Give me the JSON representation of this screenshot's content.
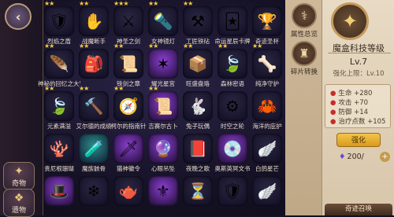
{
  "back": {
    "icon": "back-arrow-icon",
    "glyph": "‹"
  },
  "side_tabs": [
    {
      "label": "奇物",
      "icon": "curio-icon",
      "glyph": "✦"
    },
    {
      "label": "遗物",
      "icon": "relic-icon",
      "glyph": "❖"
    }
  ],
  "items": [
    {
      "name": "烈焰之盾",
      "stars": 2,
      "glyph": "🛡",
      "bg": "dim"
    },
    {
      "name": "战魔断手",
      "stars": 2,
      "glyph": "✋",
      "bg": "dim"
    },
    {
      "name": "神圣之剑",
      "stars": 3,
      "glyph": "⚔",
      "bg": "dim"
    },
    {
      "name": "女神镜灯",
      "stars": 2,
      "glyph": "🔦",
      "bg": "dim"
    },
    {
      "name": "工匠铁砧",
      "stars": 2,
      "glyph": "⚒",
      "bg": "dim"
    },
    {
      "name": "命运星辰卡牌",
      "stars": 0,
      "glyph": "🃏",
      "bg": "dim"
    },
    {
      "name": "奇迹圣杯",
      "stars": 0,
      "glyph": "🏆",
      "bg": "dim"
    },
    {
      "name": "神秘的回忆之大冒险家的背包",
      "stars": 2,
      "glyph": "🪶",
      "bg": "dim"
    },
    {
      "name": "",
      "stars": 2,
      "glyph": "🎒",
      "bg": "dim"
    },
    {
      "name": "铁剑之章",
      "stars": 2,
      "glyph": "📜",
      "bg": "dim"
    },
    {
      "name": "耀光星宫",
      "stars": 2,
      "glyph": "✶",
      "bg": "purple"
    },
    {
      "name": "旺盛盘珞",
      "stars": 2,
      "glyph": "📦",
      "bg": "dim"
    },
    {
      "name": "森林密语",
      "stars": 2,
      "glyph": "🍃",
      "bg": "dim"
    },
    {
      "name": "纯净守护",
      "stars": 2,
      "glyph": "🦴",
      "bg": "dim"
    },
    {
      "name": "元素满溢",
      "stars": 2,
      "glyph": "🍃",
      "bg": "dim"
    },
    {
      "name": "艾尔德的成绩",
      "stars": 2,
      "glyph": "🔨",
      "bg": "dim"
    },
    {
      "name": "柯尔的指南针",
      "stars": 2,
      "glyph": "🧭",
      "bg": "dim"
    },
    {
      "name": "吉赛尔古卜",
      "stars": 2,
      "glyph": "📜",
      "bg": "purple"
    },
    {
      "name": "兔子玩偶",
      "stars": 0,
      "glyph": "🐇",
      "bg": "dim"
    },
    {
      "name": "时空之轮",
      "stars": 0,
      "glyph": "⚙",
      "bg": "dim"
    },
    {
      "name": "海洋的庇护",
      "stars": 0,
      "glyph": "🦀",
      "bg": "dim"
    },
    {
      "name": "贵尼根珊瑚",
      "stars": 0,
      "glyph": "🪸",
      "bg": "dim"
    },
    {
      "name": "魔族骸骨",
      "stars": 0,
      "glyph": "🧪",
      "bg": "teal"
    },
    {
      "name": "猫神徽令",
      "stars": 0,
      "glyph": "🗡",
      "bg": "purple"
    },
    {
      "name": "心眼吊坠",
      "stars": 0,
      "glyph": "🔮",
      "bg": "purple"
    },
    {
      "name": "夜晚之歌",
      "stars": 0,
      "glyph": "📕",
      "bg": "dim"
    },
    {
      "name": "奥斯英冥文书",
      "stars": 0,
      "glyph": "💿",
      "bg": "purple"
    },
    {
      "name": "白鸽星芒",
      "stars": 0,
      "glyph": "🪽",
      "bg": "dim"
    },
    {
      "name": "",
      "stars": 0,
      "glyph": "🎩",
      "bg": "purple"
    },
    {
      "name": "",
      "stars": 0,
      "glyph": "❄",
      "bg": "dim"
    },
    {
      "name": "",
      "stars": 0,
      "glyph": "🫖",
      "bg": "dim"
    },
    {
      "name": "",
      "stars": 0,
      "glyph": "⚜",
      "bg": "purple"
    },
    {
      "name": "",
      "stars": 0,
      "glyph": "⏳",
      "bg": "dim"
    },
    {
      "name": "",
      "stars": 0,
      "glyph": "🛡",
      "bg": "dim"
    },
    {
      "name": "",
      "stars": 0,
      "glyph": "🪽",
      "bg": "dim"
    }
  ],
  "actions": [
    {
      "label": "属性总览",
      "icon": "stats-overview-icon",
      "glyph": "⚕"
    },
    {
      "label": "碎片转换",
      "icon": "shard-convert-icon",
      "glyph": "♜"
    }
  ],
  "panel": {
    "emblem_icon": "magic-box-emblem-icon",
    "emblem_glyph": "✦",
    "title": "魔盒科技等级",
    "level": "Lv.7",
    "limit": "强化上限：Lv.10",
    "stats": [
      "生命 +280",
      "攻击 +70",
      "防御 +14",
      "治疗点数 +105"
    ],
    "upgrade_label": "强化",
    "cost": "200/",
    "cost_glyph": "♦",
    "summon_label": "奇迹召唤"
  },
  "colors": {
    "accent": "#f0cf74",
    "stat_dot": "#c92b2b",
    "star": "#f6c944"
  }
}
